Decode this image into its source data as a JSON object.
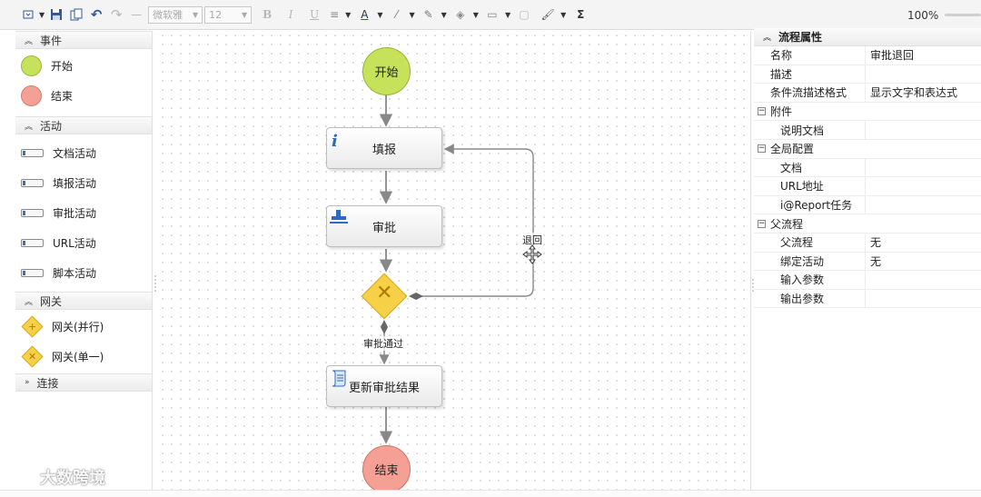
{
  "toolbar": {
    "font_name": "微软雅",
    "font_size": "12",
    "bold": "B",
    "italic": "I",
    "underline": "U",
    "zoom": "100%"
  },
  "palette": {
    "sections": [
      {
        "title": "事件",
        "expanded": true,
        "items": [
          {
            "label": "开始",
            "kind": "start-event",
            "color": "#c6e25a"
          },
          {
            "label": "结束",
            "kind": "end-event",
            "color": "#f5a094"
          }
        ]
      },
      {
        "title": "活动",
        "expanded": true,
        "items": [
          {
            "label": "文档活动",
            "kind": "task"
          },
          {
            "label": "填报活动",
            "kind": "task"
          },
          {
            "label": "审批活动",
            "kind": "task"
          },
          {
            "label": "URL活动",
            "kind": "task"
          },
          {
            "label": "脚本活动",
            "kind": "task"
          }
        ]
      },
      {
        "title": "网关",
        "expanded": true,
        "items": [
          {
            "label": "网关(并行)",
            "kind": "gateway-parallel"
          },
          {
            "label": "网关(单一)",
            "kind": "gateway-exclusive"
          }
        ]
      },
      {
        "title": "连接",
        "expanded": false,
        "items": []
      }
    ]
  },
  "diagram": {
    "start": "开始",
    "fill_task": "填报",
    "approve_task": "审批",
    "update_task": "更新审批结果",
    "end": "结束",
    "edge_reject": "退回",
    "edge_pass": "审批通过",
    "start_color": "#c6e25a",
    "end_color": "#f5a094",
    "gateway_color": "#f6d046"
  },
  "properties": {
    "title": "流程属性",
    "rows": [
      {
        "type": "row",
        "key": "名称",
        "value": "审批退回"
      },
      {
        "type": "row",
        "key": "描述",
        "value": ""
      },
      {
        "type": "row",
        "key": "条件流描述格式",
        "value": "显示文字和表达式"
      },
      {
        "type": "group",
        "key": "附件",
        "value": ""
      },
      {
        "type": "sub",
        "key": "说明文档",
        "value": ""
      },
      {
        "type": "group",
        "key": "全局配置",
        "value": ""
      },
      {
        "type": "sub",
        "key": "文档",
        "value": ""
      },
      {
        "type": "sub",
        "key": "URL地址",
        "value": ""
      },
      {
        "type": "sub",
        "key": "i@Report任务",
        "value": ""
      },
      {
        "type": "group",
        "key": "父流程",
        "value": ""
      },
      {
        "type": "sub",
        "key": "父流程",
        "value": "无"
      },
      {
        "type": "sub",
        "key": "绑定活动",
        "value": "无"
      },
      {
        "type": "sub",
        "key": "输入参数",
        "value": ""
      },
      {
        "type": "sub",
        "key": "输出参数",
        "value": ""
      }
    ]
  },
  "watermark": "大数跨境"
}
